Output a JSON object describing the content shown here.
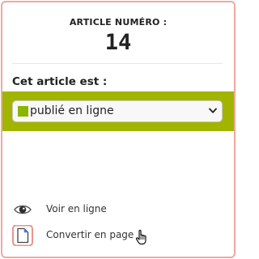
{
  "article": {
    "label": "ARTICLE NUMÉRO :",
    "number": "14"
  },
  "status": {
    "heading": "Cet article est :",
    "selected": "publié en ligne",
    "color": "#a0b400",
    "swatch_color": "#8cb400"
  },
  "actions": [
    {
      "icon": "eye-icon",
      "label": "Voir en ligne"
    },
    {
      "icon": "document-icon",
      "label": "Convertir en page"
    }
  ],
  "colors": {
    "panel_border": "#f0a8a0",
    "published_green": "#a0b400"
  }
}
